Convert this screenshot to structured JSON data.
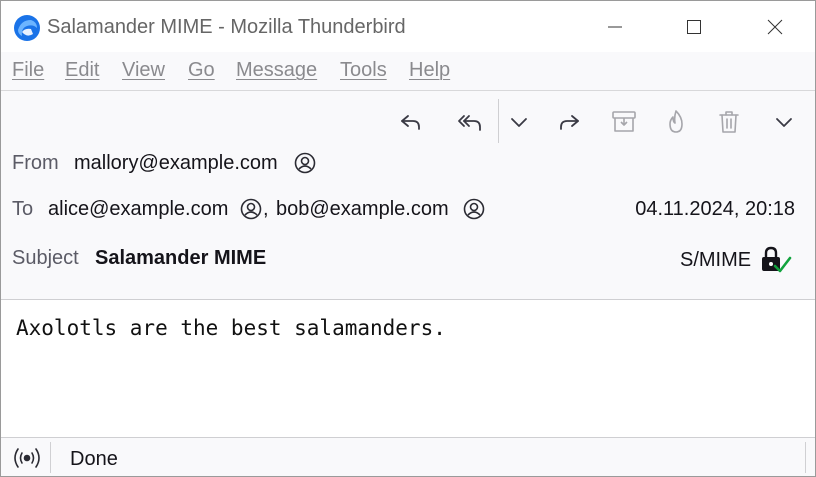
{
  "window": {
    "title": "Salamander MIME - Mozilla Thunderbird",
    "controls": [
      "minimize-icon",
      "maximize-icon",
      "close-icon"
    ]
  },
  "menubar": {
    "items": [
      "File",
      "Edit",
      "View",
      "Go",
      "Message",
      "Tools",
      "Help"
    ]
  },
  "toolbar": {
    "buttons": [
      "reply-icon",
      "reply-all-icon",
      "chevron-down-icon",
      "forward-icon",
      "archive-icon",
      "junk-icon",
      "delete-icon",
      "more-icon"
    ]
  },
  "message": {
    "from_label": "From",
    "from": "mallory@example.com",
    "to_label": "To",
    "to": [
      "alice@example.com",
      "bob@example.com"
    ],
    "to_separator": ",",
    "date": "04.11.2024, 20:18",
    "subject_label": "Subject",
    "subject": "Salamander MIME",
    "security_label": "S/MIME",
    "body": "Axolotls are the best salamanders."
  },
  "status": {
    "text": "Done",
    "icon": "online-status-icon"
  },
  "colors": {
    "accent_blue": "#0061e0",
    "check_green": "#12a33e",
    "muted_icon": "#a6a6ab"
  }
}
